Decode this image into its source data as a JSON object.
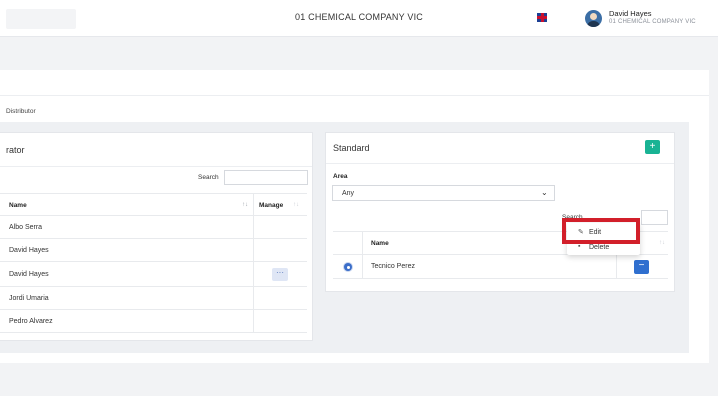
{
  "header": {
    "company_title": "01 CHEMICAL COMPANY VIC",
    "user_name": "David Hayes",
    "user_company": "01 CHEMICAL COMPANY VIC"
  },
  "main": {
    "breadcrumb": "Distributor"
  },
  "left_panel": {
    "title": "rator",
    "search_label": "Search",
    "columns": [
      "Name",
      "Manage"
    ],
    "rows": [
      "Albo Serra",
      "David Hayes",
      "David Hayes",
      "Jordi Umaria",
      "Pedro Alvarez"
    ],
    "manage_button_label": "···"
  },
  "right_panel": {
    "title": "Standard",
    "add_label": "+",
    "area_label": "Area",
    "area_value": "Any",
    "search_label": "Search",
    "column_name": "Name",
    "rows": [
      "Tecnico Perez"
    ],
    "remove_label": "−"
  },
  "context_menu": {
    "edit_label": "Edit",
    "delete_label": "Delete"
  },
  "colors": {
    "accent_green": "#19b394",
    "accent_blue": "#2f6fcf",
    "highlight_red": "#d21f2a"
  }
}
